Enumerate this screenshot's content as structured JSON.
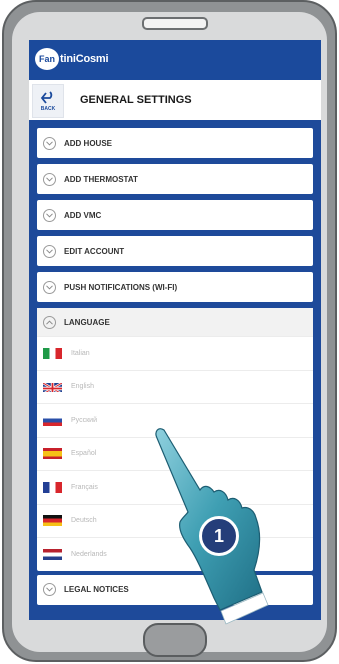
{
  "app": {
    "logo_badge": "Fan",
    "logo_text": "tiniCosmi"
  },
  "header": {
    "back_label": "BACK",
    "title": "GENERAL SETTINGS"
  },
  "menu": {
    "items": [
      {
        "label": "ADD HOUSE"
      },
      {
        "label": "ADD THERMOSTAT"
      },
      {
        "label": "ADD VMC"
      },
      {
        "label": "EDIT ACCOUNT"
      },
      {
        "label": "PUSH NOTIFICATIONS (WI-FI)"
      }
    ],
    "language": {
      "label": "LANGUAGE",
      "options": [
        {
          "name": "Italian",
          "flag": "italy"
        },
        {
          "name": "English",
          "flag": "uk"
        },
        {
          "name": "Русский",
          "flag": "russia"
        },
        {
          "name": "Español",
          "flag": "spain"
        },
        {
          "name": "Français",
          "flag": "france"
        },
        {
          "name": "Deutsch",
          "flag": "germany"
        },
        {
          "name": "Nederlands",
          "flag": "netherlands"
        }
      ]
    },
    "legal_label": "LEGAL NOTICES"
  },
  "step_badge": "1",
  "colors": {
    "brand_blue": "#1b4a9c",
    "phone_gray": "#8f9294",
    "hand_teal": "#3f9fb3"
  }
}
